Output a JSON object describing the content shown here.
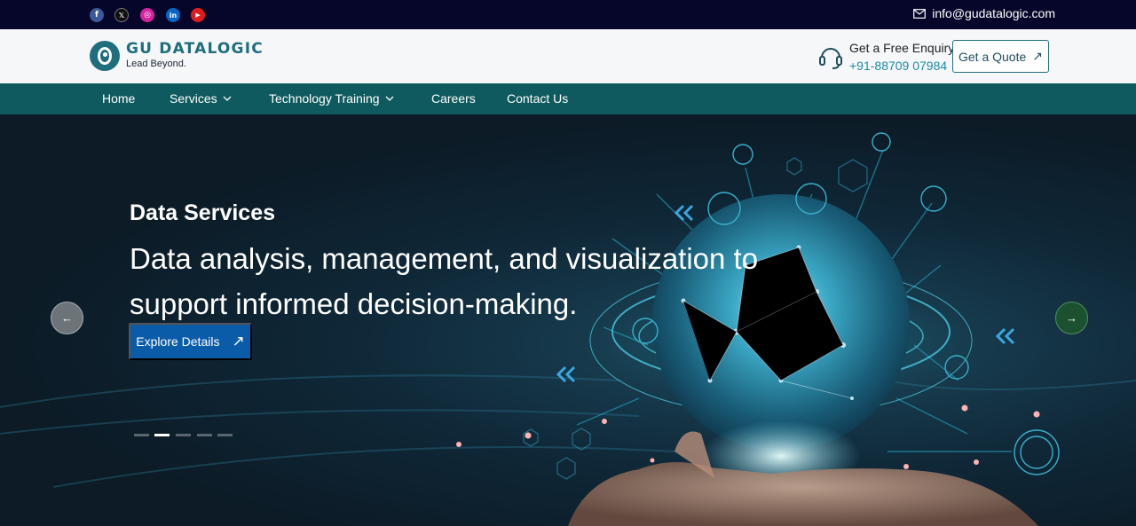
{
  "topbar": {
    "socials": [
      {
        "name": "facebook-icon",
        "glyph": "f",
        "color": "#3b5998"
      },
      {
        "name": "x-icon",
        "glyph": "𝕏",
        "color": "#101010"
      },
      {
        "name": "instagram-icon",
        "glyph": "◎",
        "color": "#d6249f"
      },
      {
        "name": "linkedin-icon",
        "glyph": "in",
        "color": "#0a66c2"
      },
      {
        "name": "youtube-icon",
        "glyph": "▶",
        "color": "#e01b1b"
      }
    ],
    "email": "info@gudatalogic.com"
  },
  "header": {
    "brand": "GU DATALOGIC",
    "tagline": "Lead Beyond.",
    "enquiry_label": "Get a Free Enquiry",
    "enquiry_phone": "+91-88709 07984",
    "quote_label": "Get a Quote",
    "quote_icon": "↗"
  },
  "nav": {
    "items": [
      {
        "label": "Home",
        "dropdown": false
      },
      {
        "label": "Services",
        "dropdown": true
      },
      {
        "label": "Technology Training",
        "dropdown": true
      },
      {
        "label": "Careers",
        "dropdown": false
      },
      {
        "label": "Contact Us",
        "dropdown": false
      }
    ]
  },
  "hero": {
    "kicker": "Data Services",
    "headline": "Data analysis, management, and visualization to support informed decision-making.",
    "cta_label": "Explore Details",
    "cta_icon": "↗",
    "prev_icon": "←",
    "next_icon": "→",
    "slide_count": 5,
    "active_slide": 2
  },
  "colors": {
    "topbar": "#06062a",
    "brand_teal": "#1f6e7d",
    "nav_bg": "#0f5a5e",
    "cta_blue": "#0b5ca8",
    "next_green": "#1c5130"
  }
}
